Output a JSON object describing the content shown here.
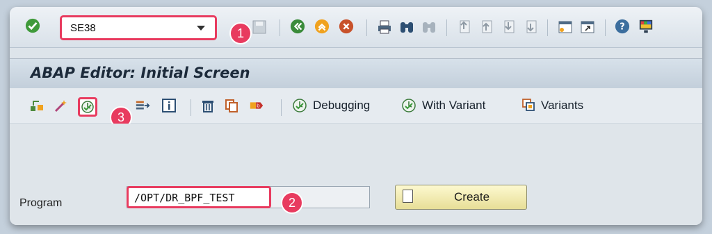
{
  "transaction": {
    "code": "SE38"
  },
  "screen": {
    "title": "ABAP Editor: Initial Screen"
  },
  "app_toolbar": {
    "debugging_label": "Debugging",
    "with_variant_label": "With Variant",
    "variants_label": "Variants"
  },
  "form": {
    "program_label": "Program",
    "program_value": "/OPT/DR_BPF_TEST",
    "create_label": "Create"
  },
  "callouts": [
    "1",
    "2",
    "3"
  ],
  "colors": {
    "callout": "#e83b5f",
    "create_button": "#f3eeb4"
  }
}
